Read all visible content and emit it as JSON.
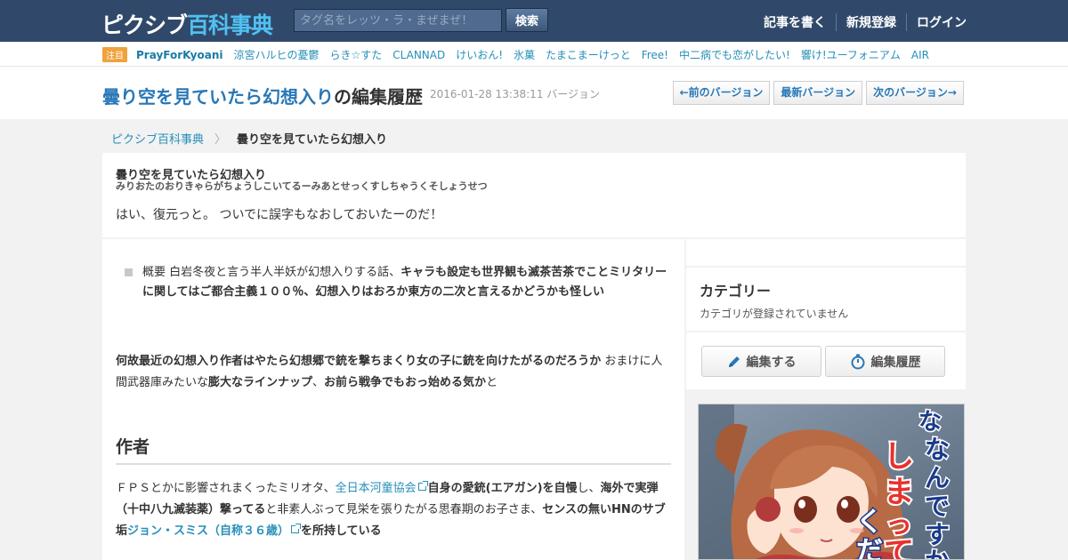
{
  "header": {
    "logo_part1": "ピクシブ",
    "logo_part2": "百科事典",
    "search_placeholder": "タグ名をレッツ・ラ・まぜまぜ！",
    "search_button": "検索",
    "nav": [
      "記事を書く",
      "新規登録",
      "ログイン"
    ]
  },
  "tagbar": {
    "badge": "注目",
    "tags": [
      "PrayForKyoani",
      "涼宮ハルヒの憂鬱",
      "らき☆すた",
      "CLANNAD",
      "けいおん!",
      "氷菓",
      "たまこまーけっと",
      "Free!",
      "中二病でも恋がしたい!",
      "響け!ユーフォニアム",
      "AIR"
    ]
  },
  "titlebar": {
    "title_link": "曇り空を見ていたら幻想入り",
    "title_suffix": "の編集履歴",
    "timestamp": "2016-01-28 13:38:11 バージョン",
    "prev_version": "←前のバージョン",
    "latest_version": "最新バージョン",
    "next_version": "次のバージョン→"
  },
  "breadcrumb": {
    "root": "ピクシブ百科事典",
    "separator": "〉",
    "current": "曇り空を見ていたら幻想入り"
  },
  "summary": {
    "title": "曇り空を見ていたら幻想入り",
    "reading": "みりおたのおりきゃらがちょうしこいてるーみあとせっくすしちゃうくそしょうせつ",
    "comment": "はい、復元っと。 ついでに誤字もなおしておいたーのだ！"
  },
  "article": {
    "abstract_plain": "概要 白岩冬夜と言う半人半妖が幻想入りする話、",
    "abstract_bold": "キャラも設定も世界観も滅茶苦茶でことミリタリーに関してはご都合主義１００％、幻想入りはおろか東方の二次と言えるかどうかも怪しい",
    "para1_bold1": "何故最近の幻想入り作者はやたら幻想郷で銃を撃ちまくり女の子に銃を向けたがるのだろうか",
    "para1_plain1": " おまけに人間武器庫みたいな",
    "para1_bold2": "膨大なラインナップ",
    "para1_plain2": "、",
    "para1_bold3": "お前ら戦争でもおっ始める気か",
    "para1_plain3": "と",
    "author_heading": "作者",
    "para2_plain1": "ＦＰＳとかに影響されまくったミリオタ、",
    "para2_link1": "全日本河童協会",
    "para2_bold1": "自身の愛銃(エアガン)を自慢",
    "para2_plain2": "し、",
    "para2_bold2": "海外で実弾（十中八九滅装薬）撃ってる",
    "para2_plain3": "と非素人ぶって見栄を張りたがる思春期のお子さま、",
    "para2_bold3": "センスの無いHNのサブ垢",
    "para2_link2": "ジョン・スミス（自称３６歳）",
    "para2_plain4": "を所持している"
  },
  "sidebar": {
    "category_heading": "カテゴリー",
    "category_empty": "カテゴリが登録されていません",
    "edit_button": "編集する",
    "history_button": "編集履歴"
  },
  "ad": {
    "text": "な なんですか しまって くだ"
  },
  "colors": {
    "header_bg": "#30496b",
    "logo_accent": "#50c0f0",
    "link": "#258fb8",
    "badge": "#f0a23c"
  }
}
